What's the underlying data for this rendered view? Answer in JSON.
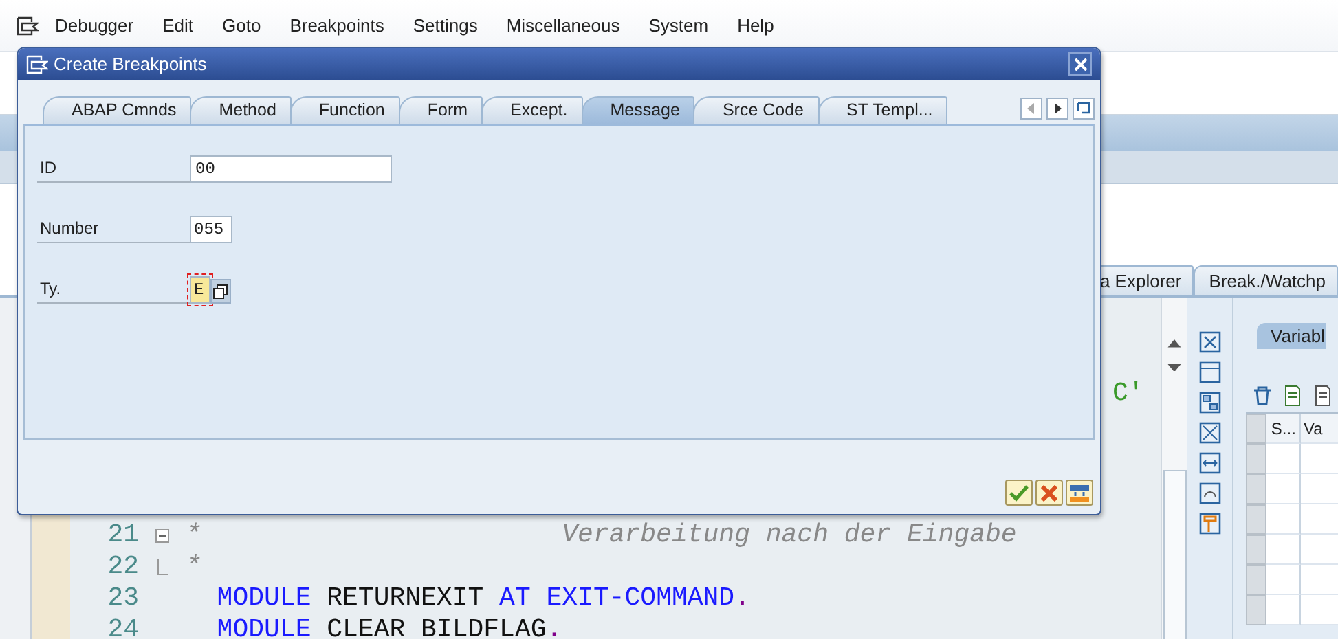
{
  "menu": {
    "items": [
      "Debugger",
      "Edit",
      "Goto",
      "Breakpoints",
      "Settings",
      "Miscellaneous",
      "System",
      "Help"
    ]
  },
  "background_tabs": [
    {
      "label": "a Explorer",
      "selected": false
    },
    {
      "label": "Break./Watchp",
      "selected": false
    }
  ],
  "editor": {
    "fragment": "C'",
    "lines": [
      {
        "number": "21",
        "kind": "fold-start",
        "tokens": [
          {
            "text": "*                       Verarbeitung nach der Eingabe",
            "kind": "comment"
          }
        ]
      },
      {
        "number": "22",
        "kind": "fold-end",
        "tokens": [
          {
            "text": "*",
            "kind": "comment"
          }
        ]
      },
      {
        "number": "23",
        "kind": "code",
        "tokens": [
          {
            "text": "  MODULE",
            "kind": "keyword"
          },
          {
            "text": " RETURNEXIT ",
            "kind": "plain"
          },
          {
            "text": "AT EXIT-COMMAND",
            "kind": "keyword"
          },
          {
            "text": ".",
            "kind": "punct"
          }
        ]
      },
      {
        "number": "24",
        "kind": "code",
        "tokens": [
          {
            "text": "  MODULE",
            "kind": "keyword"
          },
          {
            "text": " CLEAR BILDFLAG",
            "kind": "plain"
          },
          {
            "text": ".",
            "kind": "punct"
          }
        ]
      }
    ]
  },
  "variables_panel": {
    "tab": "Variabl",
    "columns": [
      "S...",
      "Va"
    ]
  },
  "dialog": {
    "title": "Create Breakpoints",
    "tabs": [
      {
        "label": "ABAP Cmnds",
        "selected": false
      },
      {
        "label": "Method",
        "selected": false
      },
      {
        "label": "Function",
        "selected": false
      },
      {
        "label": "Form",
        "selected": false
      },
      {
        "label": "Except.",
        "selected": false
      },
      {
        "label": "Message",
        "selected": true
      },
      {
        "label": "Srce Code",
        "selected": false
      },
      {
        "label": "ST Templ...",
        "selected": false
      }
    ],
    "fields": [
      {
        "label": "ID",
        "value": "00",
        "kind": "text",
        "focused": false
      },
      {
        "label": "Number",
        "value": "055",
        "kind": "short",
        "focused": false
      },
      {
        "label": "Ty.",
        "value": "E",
        "kind": "choice",
        "focused": true
      }
    ]
  }
}
